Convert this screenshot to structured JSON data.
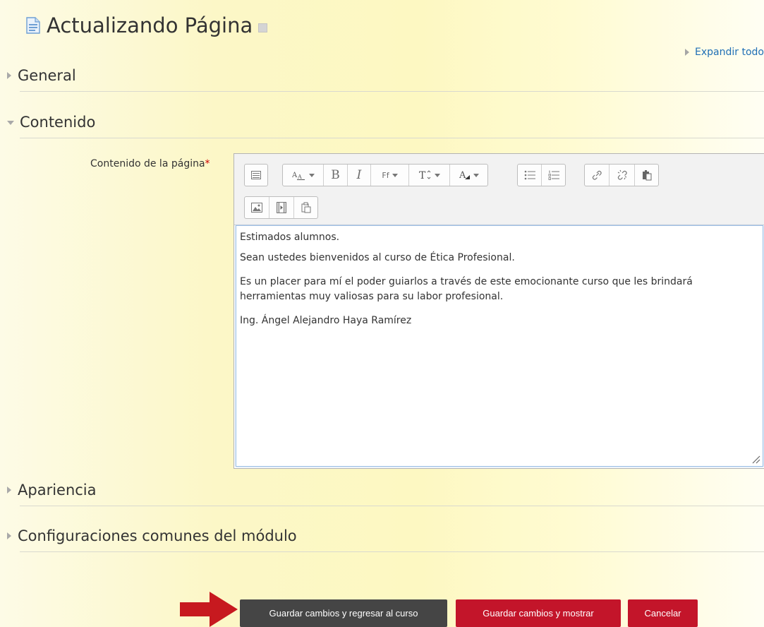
{
  "page": {
    "title": "Actualizando Página",
    "expand_all": "Expandir todo"
  },
  "sections": {
    "general": "General",
    "contenido": "Contenido",
    "apariencia": "Apariencia",
    "configuraciones": "Configuraciones comunes del módulo"
  },
  "field": {
    "label": "Contenido de la página",
    "required_mark": "*"
  },
  "toolbar": {
    "font_family": "Ff",
    "bold": "B",
    "italic": "I"
  },
  "editor": {
    "paragraphs": [
      "Estimados alumnos.",
      "Sean ustedes bienvenidos al curso de Ética Profesional.",
      "Es un placer para mí el poder guiarlos a través de este emocionante curso que les brindará",
      "herramientas muy valiosas para su labor profesional.",
      "Ing. Ángel Alejandro Haya Ramírez"
    ]
  },
  "buttons": {
    "save_return": "Guardar cambios y regresar al curso",
    "save_show": "Guardar cambios y mostrar",
    "cancel": "Cancelar"
  },
  "colors": {
    "accent_red": "#c3152a",
    "dark_button": "#454545",
    "arrow": "#c7191f",
    "link": "#1f6fb5"
  },
  "icons": [
    "page-icon",
    "help-icon",
    "toolbar-toggle-icon",
    "font-size-icon",
    "font-family-icon",
    "text-style-icon",
    "font-color-icon",
    "bullet-list-icon",
    "numbered-list-icon",
    "link-icon",
    "unlink-icon",
    "paste-icon",
    "image-icon",
    "media-icon",
    "manage-files-icon",
    "resize-grip-icon",
    "red-arrow-icon"
  ]
}
